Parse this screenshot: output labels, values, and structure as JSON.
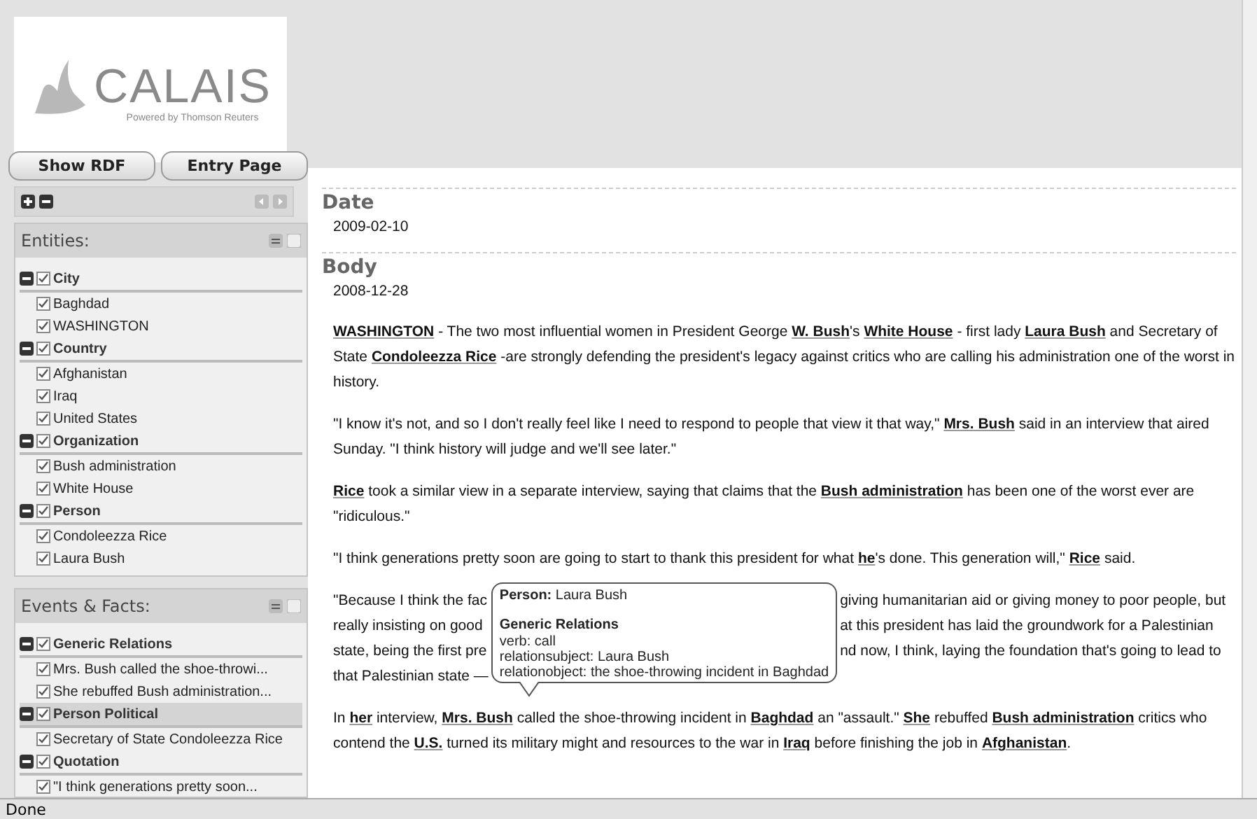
{
  "logo": {
    "name": "CALAIS",
    "tagline": "Powered by Thomson Reuters"
  },
  "buttons": [
    "Show RDF",
    "Entry Page"
  ],
  "entities": {
    "title": "Entities:",
    "groups": [
      {
        "label": "City",
        "expanded": true,
        "checked": true,
        "selected": false,
        "children": [
          {
            "label": "Baghdad",
            "checked": true
          },
          {
            "label": "WASHINGTON",
            "checked": true
          }
        ]
      },
      {
        "label": "Country",
        "expanded": true,
        "checked": true,
        "selected": false,
        "children": [
          {
            "label": "Afghanistan",
            "checked": true
          },
          {
            "label": "Iraq",
            "checked": true
          },
          {
            "label": "United States",
            "checked": true
          }
        ]
      },
      {
        "label": "Organization",
        "expanded": true,
        "checked": true,
        "selected": false,
        "children": [
          {
            "label": "Bush administration",
            "checked": true
          },
          {
            "label": "White House",
            "checked": true
          }
        ]
      },
      {
        "label": "Person",
        "expanded": true,
        "checked": true,
        "selected": false,
        "children": [
          {
            "label": "Condoleezza Rice",
            "checked": true
          },
          {
            "label": "Laura Bush",
            "checked": true
          }
        ]
      }
    ]
  },
  "events": {
    "title": "Events & Facts:",
    "groups": [
      {
        "label": "Generic Relations",
        "expanded": true,
        "checked": true,
        "selected": false,
        "children": [
          {
            "label": "Mrs. Bush called the shoe-throwi...",
            "checked": true
          },
          {
            "label": "She rebuffed Bush administration...",
            "checked": true
          }
        ]
      },
      {
        "label": "Person Political",
        "expanded": true,
        "checked": true,
        "selected": true,
        "children": [
          {
            "label": "Secretary of State Condoleezza Rice",
            "checked": true
          }
        ]
      },
      {
        "label": "Quotation",
        "expanded": true,
        "checked": true,
        "selected": false,
        "children": [
          {
            "label": "\"I think generations pretty soon...",
            "checked": true
          }
        ]
      }
    ]
  },
  "sections": [
    {
      "heading": "Date",
      "value": "2009-02-10"
    },
    {
      "heading": "Body",
      "value": "2008-12-28"
    }
  ],
  "paragraphs": [
    {
      "kind": "text",
      "text": "**WASHINGTON** - The two most influential women in President George **W. Bush**'s **White House** - first lady **Laura Bush** and Secretary of State **Condoleezza Rice** -are strongly defending the president's legacy against critics who are calling his administration one of the worst in history."
    },
    {
      "kind": "text",
      "text": "\"I know it's not, and so I don't really feel like I need to respond to people that view it that way,\" **Mrs. Bush** said in an interview that aired Sunday. \"I think history will judge and we'll see later.\""
    },
    {
      "kind": "text",
      "text": "**Rice** took a similar view in a separate interview, saying that claims that the **Bush administration** has been one of the worst ever are \"ridiculous.\""
    },
    {
      "kind": "text",
      "text": "\"I think generations pretty soon are going to start to thank this president for what **he**'s done. This generation will,\" **Rice** said."
    },
    {
      "kind": "covered",
      "lines": [
        {
          "left": "\"Because I think the fac",
          "right": "giving humanitarian aid or giving money to poor people, but"
        },
        {
          "left": "really insisting on good",
          "right": "at this president has laid the groundwork for a Palestinian"
        },
        {
          "left": "state, being the first pre",
          "right": "nd now, I think, laying the foundation that's going to lead to"
        },
        {
          "left": "that Palestinian state —"
        }
      ]
    },
    {
      "kind": "text",
      "text": "In **her** interview, **Mrs. Bush** called the shoe-throwing incident in **Baghdad** an \"assault.\" **She** rebuffed **Bush administration** critics who contend the **U.S.** turned its military might and resources to the war in **Iraq** before finishing the job in **Afghanistan**."
    }
  ],
  "tooltip": {
    "type_label": "Person:",
    "type_value": "Laura Bush",
    "heading": "Generic Relations",
    "lines": [
      "verb: call",
      "relationsubject: Laura Bush",
      "relationobject: the shoe-throwing incident in Baghdad"
    ]
  },
  "status_bar": "Done"
}
